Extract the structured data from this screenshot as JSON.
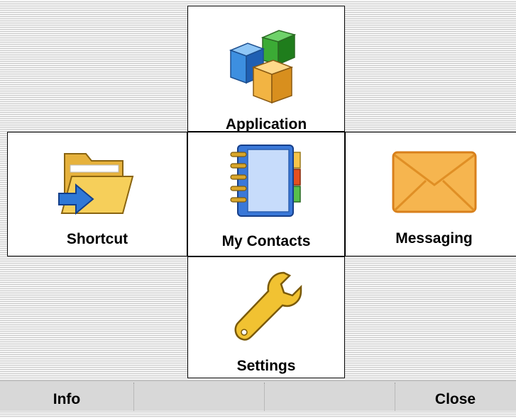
{
  "menu": {
    "application": {
      "label": "Application",
      "icon": "application-cubes-icon"
    },
    "shortcut": {
      "label": "Shortcut",
      "icon": "folder-shortcut-icon"
    },
    "contacts": {
      "label": "My Contacts",
      "icon": "address-book-icon"
    },
    "messaging": {
      "label": "Messaging",
      "icon": "envelope-icon"
    },
    "settings": {
      "label": "Settings",
      "icon": "wrench-icon"
    }
  },
  "softkeys": {
    "left": "Info",
    "right": "Close"
  }
}
